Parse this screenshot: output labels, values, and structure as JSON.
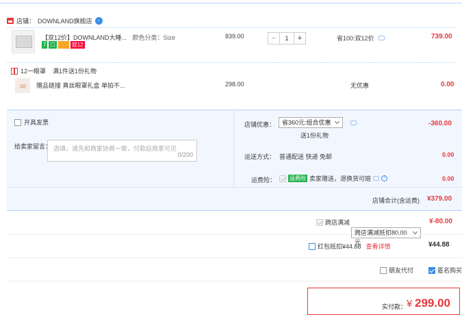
{
  "shop": {
    "label": "店铺：",
    "name": "DOWNLAND旗舰店"
  },
  "item1": {
    "title": "【双12价】DOWNLAND大睡...",
    "spec": "颜色分类：Size 1",
    "tags": [
      "7",
      "双12"
    ],
    "unit_price": "839.00",
    "quantity": "1",
    "discount": "省100:双12价",
    "subtotal": "739.00"
  },
  "gift": {
    "label": "12一眼罩",
    "desc": "满1件送1份礼物",
    "item_title": "赠品链接 真丝眼罩礼盒 单拍不...",
    "unit_price": "298.00",
    "discount": "无优惠",
    "subtotal": "0.00"
  },
  "invoice": {
    "label": "开具发票"
  },
  "message": {
    "label": "给卖家留言：",
    "placeholder": "选填，请先和商家协商一致，付款后商家可见",
    "counter": "0/200"
  },
  "shop_discount": {
    "label": "店铺优惠：",
    "selected": "省360元:组合优惠",
    "note": "送1份礼物",
    "amount": "-360.00"
  },
  "delivery": {
    "label": "运送方式：",
    "value": "普通配送 快递 免邮",
    "amount": "0.00"
  },
  "insurance": {
    "label": "运费险：",
    "tag": "运费险",
    "text": "卖家赠送，退换货可赔",
    "amount": "0.00"
  },
  "shop_total": {
    "label": "店铺合计(含运费)",
    "amount": "¥379.00"
  },
  "cross_store": {
    "label": "跨店满减",
    "selected": "跨店满减抵扣80.00元",
    "amount": "¥-80.00"
  },
  "red_packet": {
    "label": "红包抵扣¥44.88",
    "link": "查看详情",
    "amount": "¥44.88"
  },
  "friend_pay": {
    "label": "朋友代付"
  },
  "anonymous": {
    "label": "匿名购买"
  },
  "payment": {
    "label": "实付款：",
    "currency": "¥",
    "amount": "299.00"
  },
  "colors": {
    "accent_red": "#e4393c",
    "panel_blue": "#f2f7ff",
    "border_blue": "#b2d1ff"
  }
}
